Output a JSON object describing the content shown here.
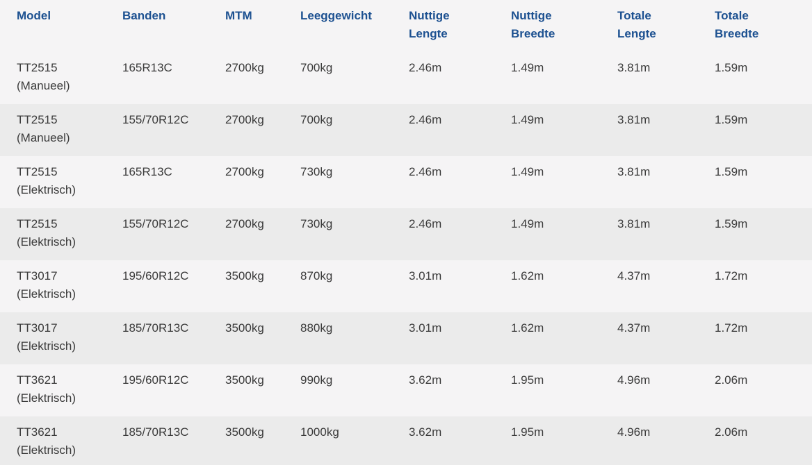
{
  "headers": [
    {
      "line1": "Model",
      "line2": ""
    },
    {
      "line1": "Banden",
      "line2": ""
    },
    {
      "line1": "MTM",
      "line2": ""
    },
    {
      "line1": "Leeggewicht",
      "line2": ""
    },
    {
      "line1": "Nuttige",
      "line2": "Lengte"
    },
    {
      "line1": "Nuttige",
      "line2": "Breedte"
    },
    {
      "line1": "Totale",
      "line2": "Lengte"
    },
    {
      "line1": "Totale",
      "line2": "Breedte"
    }
  ],
  "rows": [
    {
      "model": "TT2515",
      "variant": "(Manueel)",
      "banden": "165R13C",
      "mtm": "2700kg",
      "leeggewicht": "700kg",
      "nuttige_lengte": "2.46m",
      "nuttige_breedte": "1.49m",
      "totale_lengte": "3.81m",
      "totale_breedte": "1.59m"
    },
    {
      "model": "TT2515",
      "variant": "(Manueel)",
      "banden": "155/70R12C",
      "mtm": "2700kg",
      "leeggewicht": "700kg",
      "nuttige_lengte": "2.46m",
      "nuttige_breedte": "1.49m",
      "totale_lengte": "3.81m",
      "totale_breedte": "1.59m"
    },
    {
      "model": "TT2515",
      "variant": "(Elektrisch)",
      "banden": "165R13C",
      "mtm": "2700kg",
      "leeggewicht": "730kg",
      "nuttige_lengte": "2.46m",
      "nuttige_breedte": "1.49m",
      "totale_lengte": "3.81m",
      "totale_breedte": "1.59m"
    },
    {
      "model": "TT2515",
      "variant": "(Elektrisch)",
      "banden": "155/70R12C",
      "mtm": "2700kg",
      "leeggewicht": "730kg",
      "nuttige_lengte": "2.46m",
      "nuttige_breedte": "1.49m",
      "totale_lengte": "3.81m",
      "totale_breedte": "1.59m"
    },
    {
      "model": "TT3017",
      "variant": "(Elektrisch)",
      "banden": "195/60R12C",
      "mtm": "3500kg",
      "leeggewicht": "870kg",
      "nuttige_lengte": "3.01m",
      "nuttige_breedte": "1.62m",
      "totale_lengte": "4.37m",
      "totale_breedte": "1.72m"
    },
    {
      "model": "TT3017",
      "variant": "(Elektrisch)",
      "banden": "185/70R13C",
      "mtm": "3500kg",
      "leeggewicht": "880kg",
      "nuttige_lengte": "3.01m",
      "nuttige_breedte": "1.62m",
      "totale_lengte": "4.37m",
      "totale_breedte": "1.72m"
    },
    {
      "model": "TT3621",
      "variant": "(Elektrisch)",
      "banden": "195/60R12C",
      "mtm": "3500kg",
      "leeggewicht": "990kg",
      "nuttige_lengte": "3.62m",
      "nuttige_breedte": "1.95m",
      "totale_lengte": "4.96m",
      "totale_breedte": "2.06m"
    },
    {
      "model": "TT3621",
      "variant": "(Elektrisch)",
      "banden": "185/70R13C",
      "mtm": "3500kg",
      "leeggewicht": "1000kg",
      "nuttige_lengte": "3.62m",
      "nuttige_breedte": "1.95m",
      "totale_lengte": "4.96m",
      "totale_breedte": "2.06m"
    }
  ],
  "colors": {
    "header_text": "#1d5191",
    "body_text": "#3b3b3b",
    "row_light": "#f5f4f5",
    "row_dark": "#ebebeb"
  }
}
